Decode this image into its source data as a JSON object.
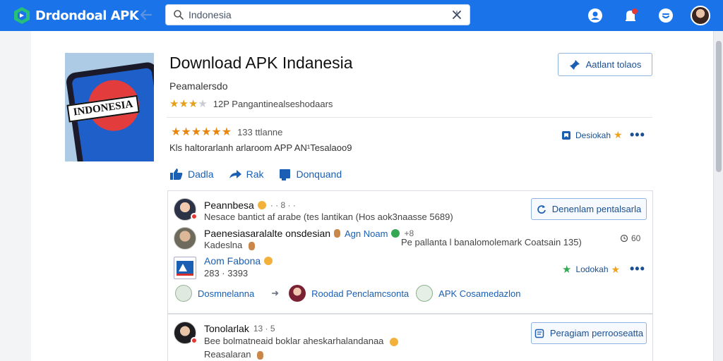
{
  "topbar": {
    "logo_text": "Drdondoal APK",
    "search": {
      "value": "Indonesia",
      "placeholder": ""
    }
  },
  "app": {
    "image_label": "INDONESIA",
    "title": "Download APK Indanesia",
    "developer": "Peamalersdo",
    "rating_summary": "12P Pangantinealseshodaars",
    "install_label": "Aatlant tolaos",
    "rating_count": "133 ttlanne",
    "description": "Kls haltorarlanh arlaroom APP AN¹Tesalaoo9",
    "bookmark_label": "Desiokah",
    "actions": {
      "like": "Dadla",
      "share": "Rak",
      "download": "Donquand"
    }
  },
  "comments": [
    {
      "name": "Peannbesa",
      "meta": "· · 8 · ·",
      "text": "Nesace bantict af arabe (tes lantikan (Hos aok3naasse 5689)",
      "reply_label": "Denenlam pentalsarla"
    },
    {
      "name": "Paenesiasaralalte onsdesian",
      "tag": "Agn Noam",
      "tag_meta": "+8",
      "text": "Kadeslna",
      "timestamp_text": "Pe pallanta l banalomolemark Coatsain 135)",
      "timestamp": "60"
    },
    {
      "name": "Aom Fabona",
      "text": "283 · 3393",
      "bookmark_label": "Lodokah"
    },
    {
      "name": "Tonolarlak",
      "meta": "13 · 5",
      "text": "Bee bolmatneaid boklar aheskarhalandanaa",
      "text2": "Reasalaran",
      "reply_label": "Peragiam perrooseatta"
    }
  ],
  "links_row": {
    "from": "Dosmnelanna",
    "item1": "Roodad Penclamcsonta",
    "item2": "APK Cosamedazlon"
  },
  "colors": {
    "topbar": "#1a73e8",
    "link": "#1a5fb4",
    "star": "#e5a01a",
    "green": "#34a853"
  }
}
